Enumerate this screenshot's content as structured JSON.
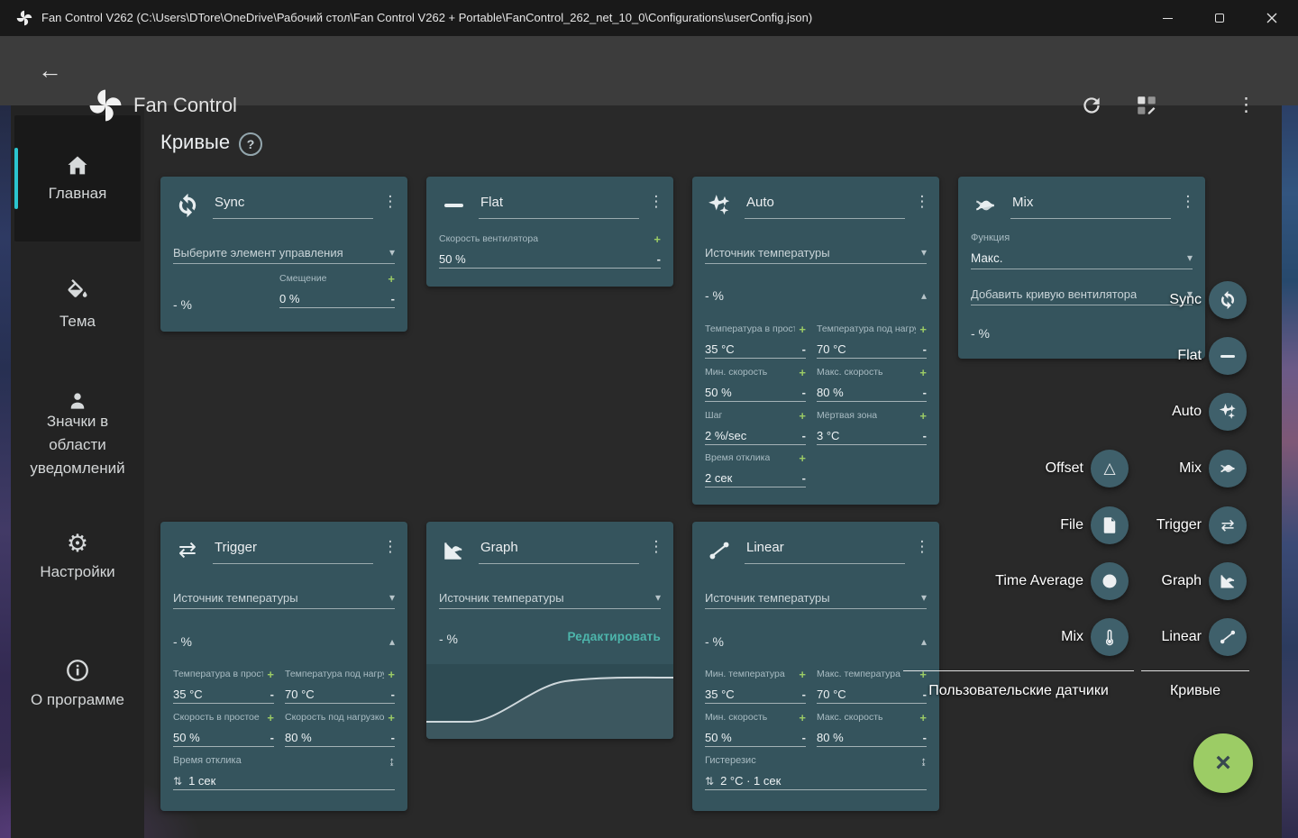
{
  "titlebar": {
    "title": "Fan Control V262 (C:\\Users\\DTore\\OneDrive\\Рабочий стол\\Fan Control V262 + Portable\\FanControl_262_net_10_0\\Configurations\\userConfig.json)"
  },
  "header": {
    "app_title": "Fan Control"
  },
  "icons": {
    "back": "←",
    "more_vert": "⋮",
    "help": "?",
    "chevron_down": "▾",
    "chevron_up": "▴",
    "plus": "+",
    "minus": "-",
    "trigger": "⇄",
    "offset": "△",
    "updown": "⇅",
    "unfold": "↨",
    "auto_star": "✦",
    "close": "×"
  },
  "sidebar": {
    "items": [
      {
        "label": "Главная",
        "icon": "home",
        "selected": true
      },
      {
        "label": "Тема",
        "icon": "color-fill",
        "selected": false
      },
      {
        "label": "Значки в области уведомлений",
        "icon": "tray-person",
        "selected": false
      },
      {
        "label": "Настройки",
        "icon": "settings-gear",
        "selected": false
      },
      {
        "label": "О программе",
        "icon": "info",
        "selected": false
      }
    ],
    "gear_glyph": "⚙"
  },
  "page": {
    "title": "Кривые"
  },
  "cards": {
    "sync": {
      "title": "Sync",
      "control_select": "Выберите элемент управления",
      "value": "- %",
      "offset_label": "Смещение",
      "offset_value": "0 %"
    },
    "flat": {
      "title": "Flat",
      "speed_label": "Скорость вентилятора",
      "speed_value": "50 %"
    },
    "auto": {
      "title": "Auto",
      "source_select": "Источник температуры",
      "value": "- %",
      "fields": {
        "idle_temp_label": "Температура в простое",
        "idle_temp_value": "35 °C",
        "load_temp_label": "Температура под нагрузкой",
        "load_temp_value": "70 °C",
        "min_speed_label": "Мин. скорость",
        "min_speed_value": "50 %",
        "max_speed_label": "Макс. скорость",
        "max_speed_value": "80 %",
        "step_label": "Шаг",
        "step_value": "2 %/sec",
        "dead_zone_label": "Мёртвая зона",
        "dead_zone_value": "3 °C",
        "response_label": "Время отклика",
        "response_value": "2 сек"
      }
    },
    "mix": {
      "title": "Mix",
      "function_label": "Функция",
      "function_value": "Макс.",
      "add_curve_select": "Добавить кривую вентилятора",
      "value": "- %"
    },
    "trigger": {
      "title": "Trigger",
      "source_select": "Источник температуры",
      "value": "- %",
      "fields": {
        "idle_temp_label": "Температура в простое",
        "idle_temp_value": "35 °C",
        "load_temp_label": "Температура под нагрузкой",
        "load_temp_value": "70 °C",
        "idle_speed_label": "Скорость в простое",
        "idle_speed_value": "50 %",
        "load_speed_label": "Скорость под нагрузкой",
        "load_speed_value": "80 %",
        "response_label": "Время отклика",
        "response_value": "1 сек"
      }
    },
    "graph": {
      "title": "Graph",
      "source_select": "Источник температуры",
      "value": "- %",
      "edit_button": "Редактировать"
    },
    "linear": {
      "title": "Linear",
      "source_select": "Источник температуры",
      "value": "- %",
      "fields": {
        "min_temp_label": "Мин. температура",
        "min_temp_value": "35 °C",
        "max_temp_label": "Макс. температура",
        "max_temp_value": "70 °C",
        "min_speed_label": "Мин. скорость",
        "min_speed_value": "50 %",
        "max_speed_label": "Макс. скорость",
        "max_speed_value": "80 %",
        "hysteresis_label": "Гистерезис",
        "hysteresis_value": "2 °C · 1 сек"
      }
    }
  },
  "fab_menu": {
    "sensors_header": "Пользовательские датчики",
    "curves_header": "Кривые",
    "sensors": [
      {
        "label": "Offset",
        "icon": "triangle"
      },
      {
        "label": "File",
        "icon": "file"
      },
      {
        "label": "Time Average",
        "icon": "clock"
      },
      {
        "label": "Mix",
        "icon": "thermometer"
      }
    ],
    "curves": [
      {
        "label": "Sync",
        "icon": "sync"
      },
      {
        "label": "Flat",
        "icon": "dash"
      },
      {
        "label": "Auto",
        "icon": "sparkles"
      },
      {
        "label": "Mix",
        "icon": "mix-curves"
      },
      {
        "label": "Trigger",
        "icon": "swap-arrows"
      },
      {
        "label": "Graph",
        "icon": "chart"
      },
      {
        "label": "Linear",
        "icon": "diagonal"
      }
    ]
  },
  "colors": {
    "accent_teal": "#2bc5cf",
    "card_bg": "#35545d",
    "plus_green": "#9ccc65",
    "edit_teal": "#4db6ac",
    "fab_green": "#9ccc65"
  }
}
